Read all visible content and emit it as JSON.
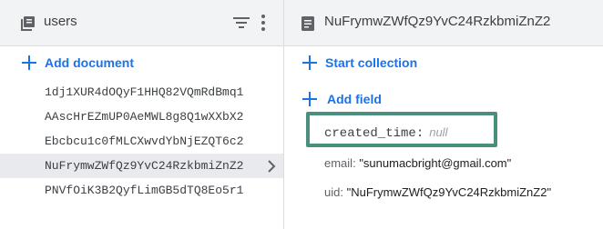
{
  "left_panel": {
    "title": "users",
    "add_document_label": "Add document",
    "documents": [
      {
        "id": "1dj1XUR4dOQyF1HHQ82VQmRdBmq1",
        "selected": false
      },
      {
        "id": "AAscHrEZmUP0AeMWL8g8Q1wXXbX2",
        "selected": false
      },
      {
        "id": "Ebcbcu1c0fMLCXwvdYbNjEZQT6c2",
        "selected": false
      },
      {
        "id": "NuFrymwZWfQz9YvC24RzkbmiZnZ2",
        "selected": true
      },
      {
        "id": "PNVfOiK3B2QyfLimGB5dTQ8Eo5r1",
        "selected": false
      }
    ]
  },
  "right_panel": {
    "title": "NuFrymwZWfQz9YvC24RzkbmiZnZ2",
    "start_collection_label": "Start collection",
    "add_field_label": "Add field",
    "fields": {
      "created_time": {
        "key": "created_time:",
        "value": "null"
      },
      "email": {
        "key": "email:",
        "value": "\"sunumacbright@gmail.com\""
      },
      "uid": {
        "key": "uid:",
        "value": "\"NuFrymwZWfQz9YvC24RzkbmiZnZ2\""
      }
    }
  },
  "colors": {
    "accent": "#1a73e8",
    "highlight": "#4a8e7e",
    "selected_row": "#e8eaed",
    "header_bg": "#f1f3f4"
  }
}
